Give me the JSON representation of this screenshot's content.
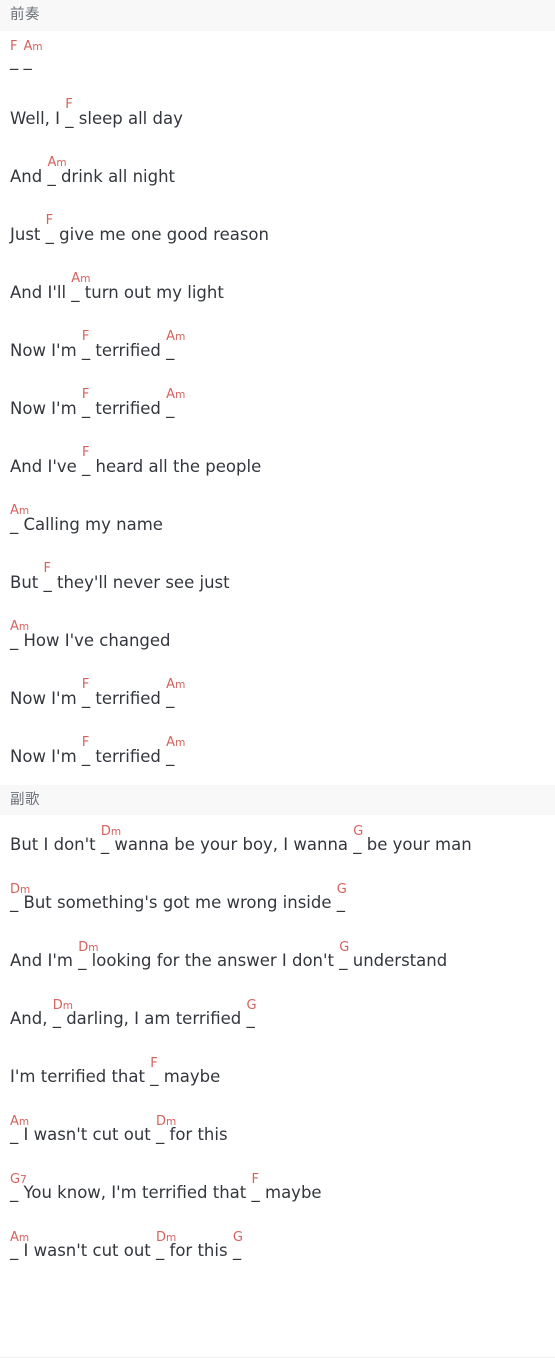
{
  "page": {
    "colors": {
      "chord": "#d6625e",
      "lyric": "#33373d",
      "section_header_bg": "#f8f8f9",
      "section_header_text": "#6b7078",
      "page_bg": "#ffffff"
    }
  },
  "sections": [
    {
      "id": "intro",
      "title": "前奏",
      "lines": [
        {
          "id": "intro-l1",
          "parts": [
            {
              "type": "slot",
              "chord": "F",
              "root": "F",
              "qual": "",
              "mark": "_"
            },
            {
              "type": "text",
              "text": "  "
            },
            {
              "type": "slot",
              "chord": "Am",
              "root": "A",
              "qual": "m",
              "mark": "_"
            }
          ]
        },
        {
          "id": "intro-l2",
          "parts": [
            {
              "type": "text",
              "text": "Well, I "
            },
            {
              "type": "slot",
              "chord": "F",
              "root": "F",
              "qual": "",
              "mark": "_"
            },
            {
              "type": "text",
              "text": " sleep all day"
            }
          ]
        },
        {
          "id": "intro-l3",
          "parts": [
            {
              "type": "text",
              "text": "And "
            },
            {
              "type": "slot",
              "chord": "Am",
              "root": "A",
              "qual": "m",
              "mark": "_"
            },
            {
              "type": "text",
              "text": " drink all night"
            }
          ]
        },
        {
          "id": "intro-l4",
          "parts": [
            {
              "type": "text",
              "text": "Just "
            },
            {
              "type": "slot",
              "chord": "F",
              "root": "F",
              "qual": "",
              "mark": "_"
            },
            {
              "type": "text",
              "text": " give me one good reason"
            }
          ]
        },
        {
          "id": "intro-l5",
          "parts": [
            {
              "type": "text",
              "text": "And I'll "
            },
            {
              "type": "slot",
              "chord": "Am",
              "root": "A",
              "qual": "m",
              "mark": "_"
            },
            {
              "type": "text",
              "text": " turn out my light"
            }
          ]
        },
        {
          "id": "intro-l6",
          "parts": [
            {
              "type": "text",
              "text": "Now I'm "
            },
            {
              "type": "slot",
              "chord": "F",
              "root": "F",
              "qual": "",
              "mark": "_"
            },
            {
              "type": "text",
              "text": " terrified "
            },
            {
              "type": "slot",
              "chord": "Am",
              "root": "A",
              "qual": "m",
              "mark": "_"
            }
          ]
        },
        {
          "id": "intro-l7",
          "parts": [
            {
              "type": "text",
              "text": "Now I'm "
            },
            {
              "type": "slot",
              "chord": "F",
              "root": "F",
              "qual": "",
              "mark": "_"
            },
            {
              "type": "text",
              "text": " terrified "
            },
            {
              "type": "slot",
              "chord": "Am",
              "root": "A",
              "qual": "m",
              "mark": "_"
            }
          ]
        },
        {
          "id": "intro-l8",
          "parts": [
            {
              "type": "text",
              "text": "And I've "
            },
            {
              "type": "slot",
              "chord": "F",
              "root": "F",
              "qual": "",
              "mark": "_"
            },
            {
              "type": "text",
              "text": " heard all the people"
            }
          ]
        },
        {
          "id": "intro-l9",
          "parts": [
            {
              "type": "slot",
              "chord": "Am",
              "root": "A",
              "qual": "m",
              "mark": "_"
            },
            {
              "type": "text",
              "text": " Calling my name"
            }
          ]
        },
        {
          "id": "intro-l10",
          "parts": [
            {
              "type": "text",
              "text": "But "
            },
            {
              "type": "slot",
              "chord": "F",
              "root": "F",
              "qual": "",
              "mark": "_"
            },
            {
              "type": "text",
              "text": " they'll never see just"
            }
          ]
        },
        {
          "id": "intro-l11",
          "parts": [
            {
              "type": "slot",
              "chord": "Am",
              "root": "A",
              "qual": "m",
              "mark": "_"
            },
            {
              "type": "text",
              "text": " How I've changed"
            }
          ]
        },
        {
          "id": "intro-l12",
          "parts": [
            {
              "type": "text",
              "text": "Now I'm "
            },
            {
              "type": "slot",
              "chord": "F",
              "root": "F",
              "qual": "",
              "mark": "_"
            },
            {
              "type": "text",
              "text": " terrified "
            },
            {
              "type": "slot",
              "chord": "Am",
              "root": "A",
              "qual": "m",
              "mark": "_"
            }
          ]
        },
        {
          "id": "intro-l13",
          "parts": [
            {
              "type": "text",
              "text": "Now I'm "
            },
            {
              "type": "slot",
              "chord": "F",
              "root": "F",
              "qual": "",
              "mark": "_"
            },
            {
              "type": "text",
              "text": " terrified "
            },
            {
              "type": "slot",
              "chord": "Am",
              "root": "A",
              "qual": "m",
              "mark": "_"
            }
          ]
        }
      ]
    },
    {
      "id": "chorus",
      "title": "副歌",
      "lines": [
        {
          "id": "chorus-l1",
          "parts": [
            {
              "type": "text",
              "text": "But I don't "
            },
            {
              "type": "slot",
              "chord": "Dm",
              "root": "D",
              "qual": "m",
              "mark": "_"
            },
            {
              "type": "text",
              "text": " wanna be your boy, I wanna "
            },
            {
              "type": "slot",
              "chord": "G",
              "root": "G",
              "qual": "",
              "mark": "_"
            },
            {
              "type": "text",
              "text": " be your man"
            }
          ]
        },
        {
          "id": "chorus-l2",
          "parts": [
            {
              "type": "slot",
              "chord": "Dm",
              "root": "D",
              "qual": "m",
              "mark": "_"
            },
            {
              "type": "text",
              "text": " But something's got me wrong inside "
            },
            {
              "type": "slot",
              "chord": "G",
              "root": "G",
              "qual": "",
              "mark": "_"
            }
          ]
        },
        {
          "id": "chorus-l3",
          "parts": [
            {
              "type": "text",
              "text": "And I'm "
            },
            {
              "type": "slot",
              "chord": "Dm",
              "root": "D",
              "qual": "m",
              "mark": "_"
            },
            {
              "type": "text",
              "text": " looking for the answer I don't "
            },
            {
              "type": "slot",
              "chord": "G",
              "root": "G",
              "qual": "",
              "mark": "_"
            },
            {
              "type": "text",
              "text": " understand"
            }
          ]
        },
        {
          "id": "chorus-l4",
          "parts": [
            {
              "type": "text",
              "text": "And, "
            },
            {
              "type": "slot",
              "chord": "Dm",
              "root": "D",
              "qual": "m",
              "mark": "_"
            },
            {
              "type": "text",
              "text": " darling, I am terrified "
            },
            {
              "type": "slot",
              "chord": "G",
              "root": "G",
              "qual": "",
              "mark": "_"
            }
          ]
        },
        {
          "id": "chorus-l5",
          "parts": [
            {
              "type": "text",
              "text": "I'm terrified that "
            },
            {
              "type": "slot",
              "chord": "F",
              "root": "F",
              "qual": "",
              "mark": "_"
            },
            {
              "type": "text",
              "text": " maybe"
            }
          ]
        },
        {
          "id": "chorus-l6",
          "parts": [
            {
              "type": "slot",
              "chord": "Am",
              "root": "A",
              "qual": "m",
              "mark": "_"
            },
            {
              "type": "text",
              "text": " I wasn't cut out "
            },
            {
              "type": "slot",
              "chord": "Dm",
              "root": "D",
              "qual": "m",
              "mark": "_"
            },
            {
              "type": "text",
              "text": " for this"
            }
          ]
        },
        {
          "id": "chorus-l7",
          "parts": [
            {
              "type": "slot",
              "chord": "G7",
              "root": "G",
              "qual": "7",
              "mark": "_"
            },
            {
              "type": "text",
              "text": " You know, I'm terrified that "
            },
            {
              "type": "slot",
              "chord": "F",
              "root": "F",
              "qual": "",
              "mark": "_"
            },
            {
              "type": "text",
              "text": " maybe"
            }
          ]
        },
        {
          "id": "chorus-l8",
          "parts": [
            {
              "type": "slot",
              "chord": "Am",
              "root": "A",
              "qual": "m",
              "mark": "_"
            },
            {
              "type": "text",
              "text": " I wasn't cut out "
            },
            {
              "type": "slot",
              "chord": "Dm",
              "root": "D",
              "qual": "m",
              "mark": "_"
            },
            {
              "type": "text",
              "text": " for this "
            },
            {
              "type": "slot",
              "chord": "G",
              "root": "G",
              "qual": "",
              "mark": "_"
            }
          ]
        }
      ]
    }
  ]
}
